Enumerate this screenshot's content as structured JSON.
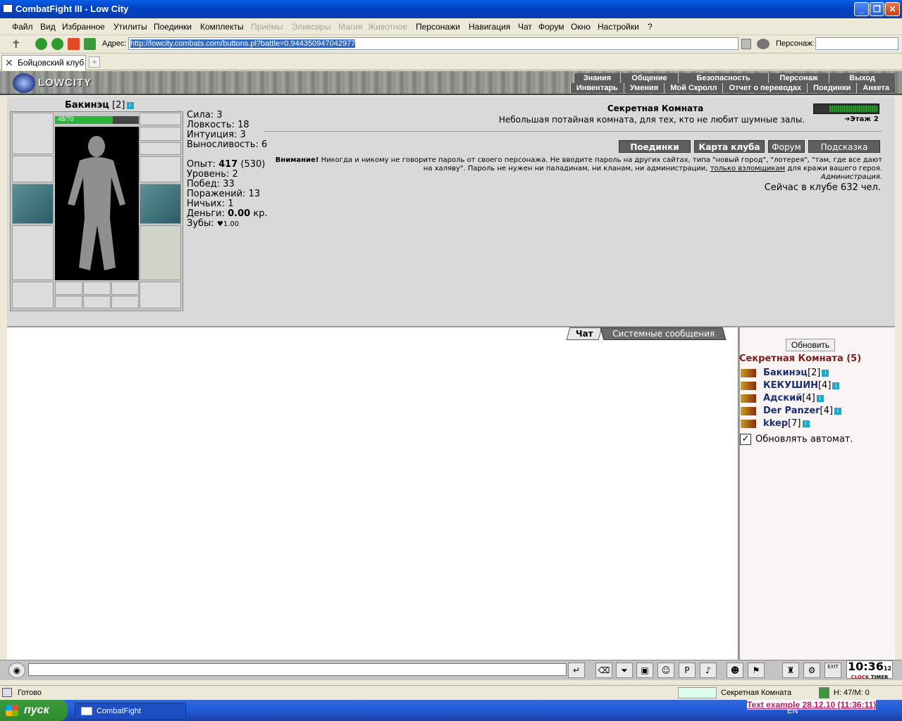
{
  "window": {
    "title": "CombatFight III - Low City"
  },
  "menu": {
    "items": [
      {
        "label": "Файл",
        "enabled": true
      },
      {
        "label": "Вид",
        "enabled": true
      },
      {
        "label": "Избранное",
        "enabled": true
      },
      {
        "label": "Утилиты",
        "enabled": true
      },
      {
        "label": "Поединки",
        "enabled": true
      },
      {
        "label": "Комплекты",
        "enabled": true
      },
      {
        "label": "Приёмы",
        "enabled": false
      },
      {
        "label": "Эликсиры",
        "enabled": false
      },
      {
        "label": "Магия",
        "enabled": false
      },
      {
        "label": "Животное",
        "enabled": false
      },
      {
        "label": "Персонажи",
        "enabled": true
      },
      {
        "label": "Навигация",
        "enabled": true
      },
      {
        "label": "Чат",
        "enabled": true
      },
      {
        "label": "Форум",
        "enabled": true
      },
      {
        "label": "Окно",
        "enabled": true
      },
      {
        "label": "Настройки",
        "enabled": true
      },
      {
        "label": "?",
        "enabled": true
      }
    ]
  },
  "address": {
    "label": "Адрес:",
    "url": "http://lowcity.combats.com/buttons.pl?battle=0.944350947042977",
    "persona_label": "Персонаж:"
  },
  "tab": {
    "label": "Бойцовский клуб"
  },
  "logo": {
    "text": "LOWCITY"
  },
  "nav_top": [
    "Знания",
    "Общение",
    "Безопасность",
    "Персонаж",
    "Выход"
  ],
  "nav_bottom": [
    "Инвентарь",
    "Умения",
    "Мой Скролл",
    "Отчет о переводах",
    "Поединки",
    "Анкета"
  ],
  "character": {
    "name": "Бакинэц",
    "level": "[2]",
    "hp_text": "48/70",
    "hp_fraction": 0.686,
    "stats": [
      "Сила: 3",
      "Ловкость: 18",
      "Интуиция: 3",
      "Выносливость: 6"
    ],
    "exp_label": "Опыт:",
    "exp_value": "417",
    "exp_next": "(530)",
    "level_line": "Уровень: 2",
    "wins": "Побед: 33",
    "losses": "Поражений: 13",
    "draws": "Ничьих: 1",
    "money_label": "Деньги:",
    "money_value": "0.00",
    "money_unit": "кр.",
    "teeth_label": "Зубы:",
    "teeth_value": "1.00"
  },
  "room": {
    "title": "Секретная Комната",
    "description": "Небольшая потайная комната, для тех, кто не любит шумные залы.",
    "floor": "Этаж 2",
    "buttons": [
      "Поединки",
      "Карта клуба",
      "Форум",
      "Подсказка"
    ],
    "warning_bold": "Внимание!",
    "warning_text": "Никогда и никому не говорите пароль от своего персонажа. Не вводите пароль на других сайтах, типа \"новый город\", \"лотерея\", \"там, где все дают на халяву\". Пароль не нужен ни паладинам, ни кланам, ни администрации,",
    "warning_link": "только взломщикам",
    "warning_tail": "для кражи вашего героя.",
    "warning_sign": "Администрация.",
    "online": "Сейчас в клубе 632 чел."
  },
  "chat": {
    "tabs": [
      "Чат",
      "Системные сообщения"
    ]
  },
  "users": {
    "refresh_label": "Обновить",
    "room_heading": "Секретная Комната (5)",
    "list": [
      {
        "nick": "Бакинэц",
        "level": "[2]"
      },
      {
        "nick": "КЕКУШИН",
        "level": "[4]"
      },
      {
        "nick": "Адский",
        "level": "[4]"
      },
      {
        "nick": "Der Panzer",
        "level": "[4]"
      },
      {
        "nick": "kkep",
        "level": "[7]"
      }
    ],
    "auto_label": "Обновлять автомат."
  },
  "clock": {
    "time": "10:36",
    "sec": "12",
    "clock_label": "CLOCK",
    "timer_label": "TIMER",
    "exit_label": "EXIT"
  },
  "status": {
    "ready": "Готово",
    "room": "Секретная Комната",
    "hm": "Н: 47/М: 0"
  },
  "taskbar": {
    "start": "пуск",
    "task": "CombatFight",
    "lang": "EN"
  },
  "overlay": {
    "text": "Text example 28.12.10 (11:36:11)"
  }
}
